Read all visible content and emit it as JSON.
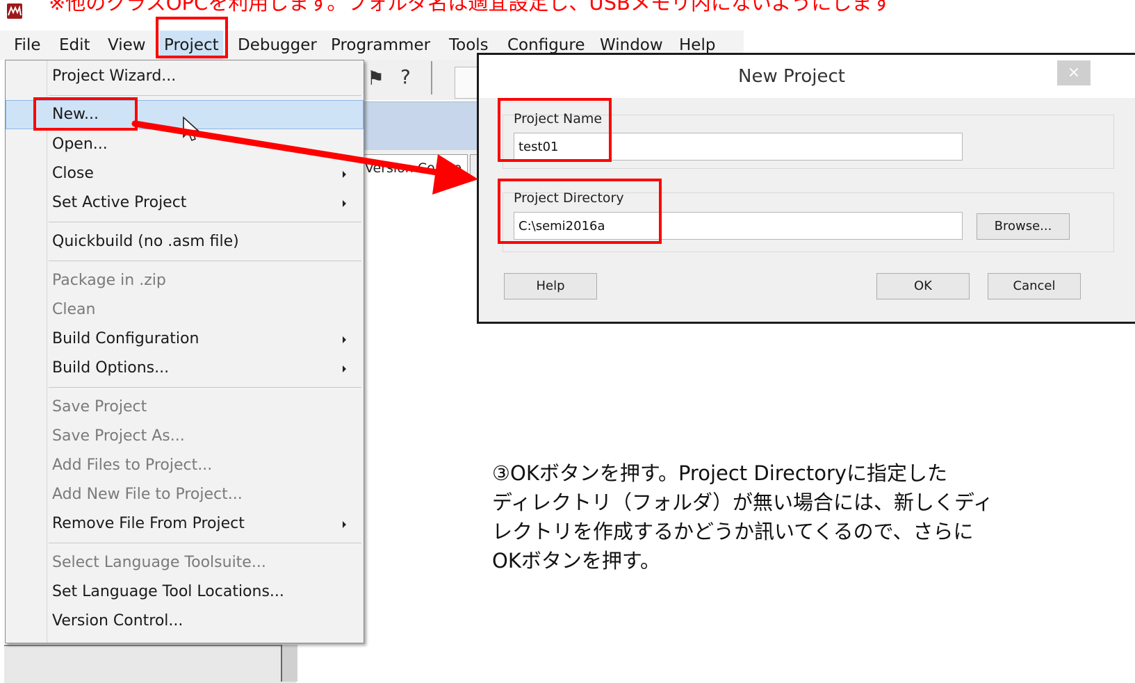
{
  "top_note": "※他のクラスOPCを利用します。フォルダ名は適宜設定し、USBメモリ内にないようにします",
  "menubar": {
    "items": [
      "File",
      "Edit",
      "View",
      "Project",
      "Debugger",
      "Programmer",
      "Tools",
      "Configure",
      "Window",
      "Help"
    ],
    "active": "Project"
  },
  "project_menu": {
    "items": [
      {
        "label": "Project Wizard..."
      },
      {
        "label": "New..."
      },
      {
        "label": "Open..."
      },
      {
        "label": "Close"
      },
      {
        "label": "Set Active Project"
      },
      {
        "label": "Quickbuild (no .asm file)"
      },
      {
        "label": "Package in .zip"
      },
      {
        "label": "Clean"
      },
      {
        "label": "Build Configuration"
      },
      {
        "label": "Build Options..."
      },
      {
        "label": "Save Project"
      },
      {
        "label": "Save Project As..."
      },
      {
        "label": "Add Files to Project..."
      },
      {
        "label": "Add New File to Project..."
      },
      {
        "label": "Remove File From Project"
      },
      {
        "label": "Select Language Toolsuite..."
      },
      {
        "label": "Set Language Tool Locations..."
      },
      {
        "label": "Version Control..."
      }
    ],
    "highlighted": "New...",
    "disabled": [
      "Package in .zip",
      "Clean",
      "Save Project",
      "Save Project As...",
      "Add Files to Project...",
      "Add New File to Project...",
      "Select Language Toolsuite..."
    ]
  },
  "background_window": {
    "tab_label": "Version Contro"
  },
  "dialog": {
    "title": "New Project",
    "close_symbol": "×",
    "project_name_label": "Project Name",
    "project_name_value": "test01",
    "project_dir_label": "Project Directory",
    "project_dir_value": "C:\\semi2016a",
    "browse_button": "Browse...",
    "help_button": "Help",
    "ok_button": "OK",
    "cancel_button": "Cancel"
  },
  "instruction": {
    "lines": [
      "③OKボタンを押す。Project Directoryに指定した",
      "ディレクトリ（フォルダ）が無い場合には、新しくディ",
      "レクトリを作成するかどうか訊いてくるので、さらに",
      "OKボタンを押す。"
    ]
  },
  "colors": {
    "annotation_red": "#ff0000",
    "menu_highlight": "#cfe3f7",
    "menubar_active": "#cde2f6"
  }
}
